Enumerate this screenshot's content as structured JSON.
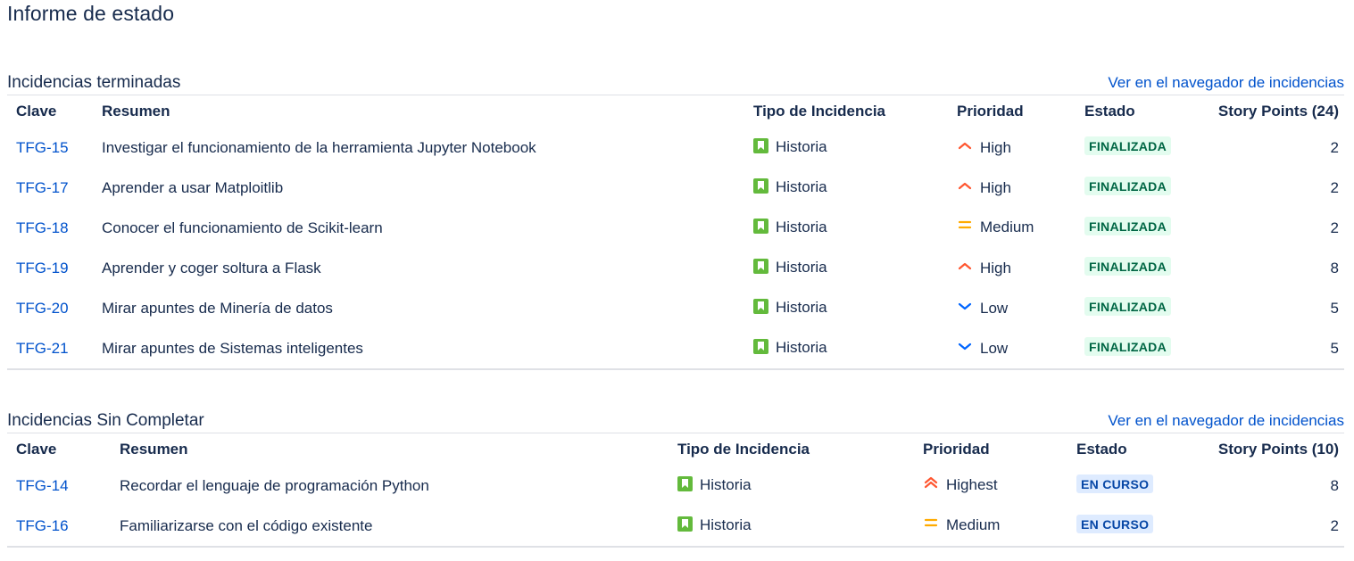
{
  "page": {
    "title": "Informe de estado"
  },
  "colors": {
    "link": "#0052cc",
    "story": "#63ba3c",
    "priority_high": "#ff5630",
    "priority_medium": "#ffab00",
    "priority_low": "#0065ff",
    "done_bg": "#e3fcef",
    "done_text": "#006644",
    "progress_bg": "#deebff",
    "progress_text": "#0747a6"
  },
  "completed": {
    "title": "Incidencias terminadas",
    "link": "Ver en el navegador de incidencias",
    "columns": {
      "key": "Clave",
      "summary": "Resumen",
      "type": "Tipo de Incidencia",
      "priority": "Prioridad",
      "status": "Estado",
      "points": "Story Points (24)"
    },
    "rows": [
      {
        "key": "TFG-15",
        "summary": "Investigar el funcionamiento de la herramienta Jupyter Notebook",
        "type": "Historia",
        "type_icon": "story-icon",
        "priority": "High",
        "priority_icon": "priority-high-icon",
        "status": "FINALIZADA",
        "points": "2"
      },
      {
        "key": "TFG-17",
        "summary": "Aprender a usar Matploitlib",
        "type": "Historia",
        "type_icon": "story-icon",
        "priority": "High",
        "priority_icon": "priority-high-icon",
        "status": "FINALIZADA",
        "points": "2"
      },
      {
        "key": "TFG-18",
        "summary": "Conocer el funcionamiento de Scikit-learn",
        "type": "Historia",
        "type_icon": "story-icon",
        "priority": "Medium",
        "priority_icon": "priority-medium-icon",
        "status": "FINALIZADA",
        "points": "2"
      },
      {
        "key": "TFG-19",
        "summary": "Aprender y coger soltura a Flask",
        "type": "Historia",
        "type_icon": "story-icon",
        "priority": "High",
        "priority_icon": "priority-high-icon",
        "status": "FINALIZADA",
        "points": "8"
      },
      {
        "key": "TFG-20",
        "summary": "Mirar apuntes de Minería de datos",
        "type": "Historia",
        "type_icon": "story-icon",
        "priority": "Low",
        "priority_icon": "priority-low-icon",
        "status": "FINALIZADA",
        "points": "5"
      },
      {
        "key": "TFG-21",
        "summary": "Mirar apuntes de Sistemas inteligentes",
        "type": "Historia",
        "type_icon": "story-icon",
        "priority": "Low",
        "priority_icon": "priority-low-icon",
        "status": "FINALIZADA",
        "points": "5"
      }
    ]
  },
  "incomplete": {
    "title": "Incidencias Sin Completar",
    "link": "Ver en el navegador de incidencias",
    "columns": {
      "key": "Clave",
      "summary": "Resumen",
      "type": "Tipo de Incidencia",
      "priority": "Prioridad",
      "status": "Estado",
      "points": "Story Points (10)"
    },
    "rows": [
      {
        "key": "TFG-14",
        "summary": "Recordar el lenguaje de programación Python",
        "type": "Historia",
        "type_icon": "story-icon",
        "priority": "Highest",
        "priority_icon": "priority-highest-icon",
        "status": "EN CURSO",
        "points": "8"
      },
      {
        "key": "TFG-16",
        "summary": "Familiarizarse con el código existente",
        "type": "Historia",
        "type_icon": "story-icon",
        "priority": "Medium",
        "priority_icon": "priority-medium-icon",
        "status": "EN CURSO",
        "points": "2"
      }
    ]
  }
}
